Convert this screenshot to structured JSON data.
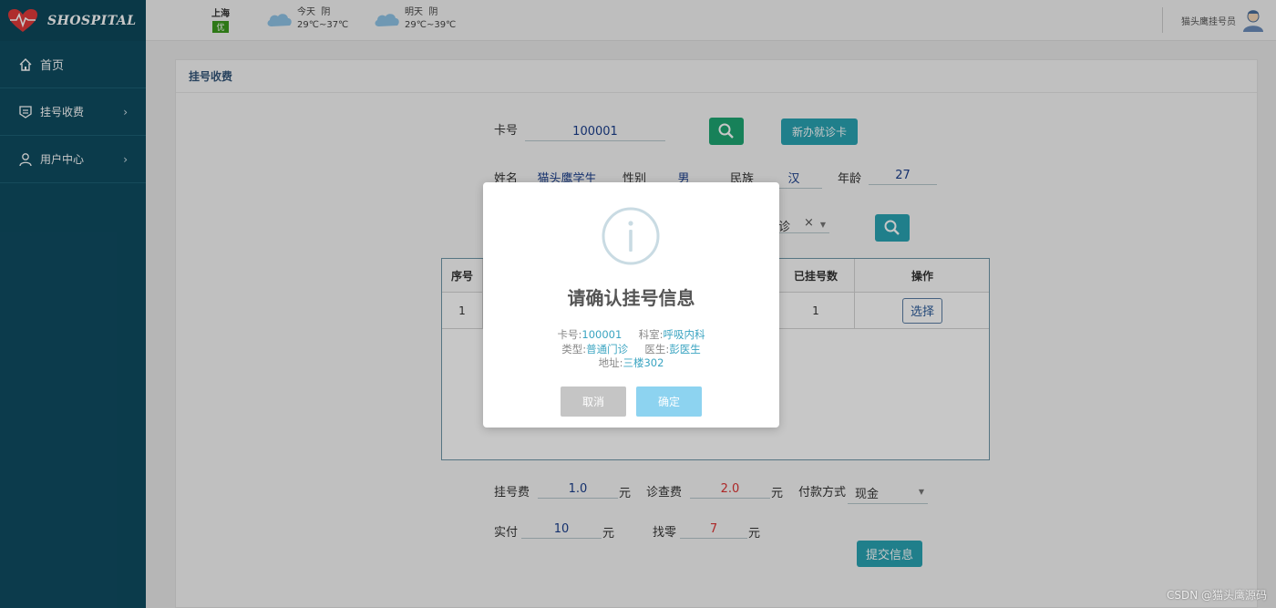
{
  "app": {
    "name": "SHOSPITAL"
  },
  "sidebar": {
    "items": [
      {
        "label": "首页"
      },
      {
        "label": "挂号收费"
      },
      {
        "label": "用户中心"
      }
    ]
  },
  "header": {
    "city": "上海",
    "aqi": "优",
    "today": {
      "label": "今天",
      "weather": "阴",
      "temp": "29℃~37℃"
    },
    "tomorrow": {
      "label": "明天",
      "weather": "阴",
      "temp": "29℃~39℃"
    },
    "user": "猫头鹰挂号员"
  },
  "panel": {
    "title": "挂号收费"
  },
  "form": {
    "card_label": "卡号",
    "card_value": "100001",
    "new_card_button": "新办就诊卡",
    "name_label": "姓名",
    "name_value": "猫头鹰学生",
    "gender_label": "性别",
    "gender_value": "男",
    "ethnic_label": "民族",
    "ethnic_value": "汉",
    "age_label": "年龄",
    "age_value": "27",
    "type_partial": "诊",
    "clear_glyph": "×"
  },
  "table": {
    "headers": {
      "index": "序号",
      "count": "已挂号数",
      "action": "操作"
    },
    "rows": [
      {
        "index": "1",
        "count": "1",
        "action": "选择"
      }
    ]
  },
  "fees": {
    "reg_fee_label": "挂号费",
    "reg_fee_value": "1.0",
    "unit": "元",
    "exam_fee_label": "诊查费",
    "exam_fee_value": "2.0",
    "pay_label": "付款方式",
    "pay_value": "现金",
    "paid_label": "实付",
    "paid_value": "10",
    "change_label": "找零",
    "change_value": "7",
    "submit_button": "提交信息"
  },
  "modal": {
    "title": "请确认挂号信息",
    "card_label": "卡号:",
    "card_value": "100001",
    "dept_label": "科室:",
    "dept_value": "呼吸内科",
    "type_label": "类型:",
    "type_value": "普通门诊",
    "doctor_label": "医生:",
    "doctor_value": "彭医生",
    "address_label": "地址:",
    "address_value": "三楼302",
    "cancel": "取消",
    "confirm": "确定"
  },
  "watermark": "CSDN @猫头鹰源码",
  "colors": {
    "sidebar": "#0f4c61",
    "teal": "#2aa3b3",
    "green": "#1ea672",
    "confirm": "#8dd3f0",
    "cancel": "#c5c5c5"
  }
}
